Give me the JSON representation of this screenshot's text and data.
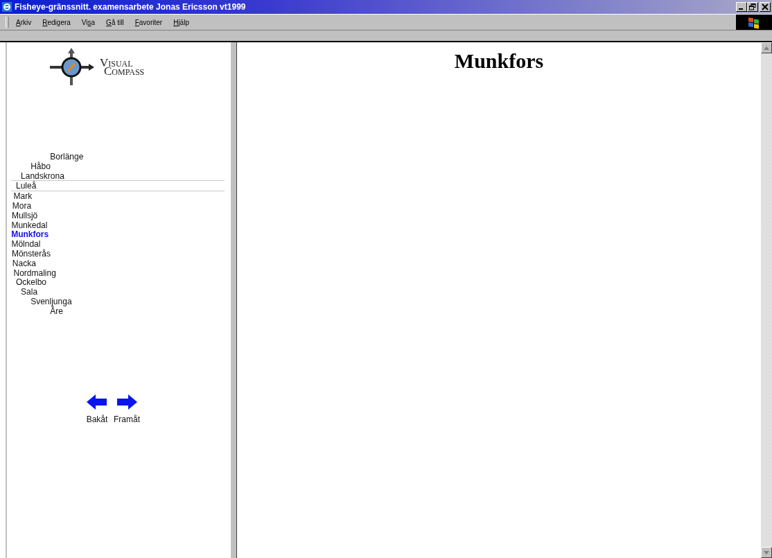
{
  "window": {
    "title": "Fisheye-gränssnitt. examensarbete Jonas Ericsson vt1999"
  },
  "menu": [
    {
      "access_key": "A",
      "rest": "rkiv"
    },
    {
      "access_key": "R",
      "rest": "edigera"
    },
    {
      "start": "Vi",
      "access_key": "s",
      "rest": "a"
    },
    {
      "access_key": "G",
      "rest": "å till"
    },
    {
      "access_key": "F",
      "rest": "avoriter"
    },
    {
      "access_key": "H",
      "rest": "jälp"
    }
  ],
  "logo": {
    "line_1": "Visual",
    "line_2": "Compass"
  },
  "places": [
    {
      "name": "Borlänge",
      "selected": false,
      "hovered": false
    },
    {
      "name": "Håbo",
      "selected": false,
      "hovered": false
    },
    {
      "name": "Landskrona",
      "selected": false,
      "hovered": false
    },
    {
      "name": "Luleå",
      "selected": false,
      "hovered": true
    },
    {
      "name": "Mark",
      "selected": false,
      "hovered": false
    },
    {
      "name": "Mora",
      "selected": false,
      "hovered": false
    },
    {
      "name": "Mullsjö",
      "selected": false,
      "hovered": false
    },
    {
      "name": "Munkedal",
      "selected": false,
      "hovered": false
    },
    {
      "name": "Munkfors",
      "selected": true,
      "hovered": false
    },
    {
      "name": "Mölndal",
      "selected": false,
      "hovered": false
    },
    {
      "name": "Mönsterås",
      "selected": false,
      "hovered": false
    },
    {
      "name": "Nacka",
      "selected": false,
      "hovered": false
    },
    {
      "name": "Nordmaling",
      "selected": false,
      "hovered": false
    },
    {
      "name": "Ockelbo",
      "selected": false,
      "hovered": false
    },
    {
      "name": "Sala",
      "selected": false,
      "hovered": false
    },
    {
      "name": "Svenljunga",
      "selected": false,
      "hovered": false
    },
    {
      "name": "Åre",
      "selected": false,
      "hovered": false
    }
  ],
  "nav": [
    {
      "kind": "back",
      "label": "Bakåt"
    },
    {
      "kind": "forward",
      "label": "Framåt"
    }
  ],
  "page": {
    "heading": "Munkfors"
  }
}
